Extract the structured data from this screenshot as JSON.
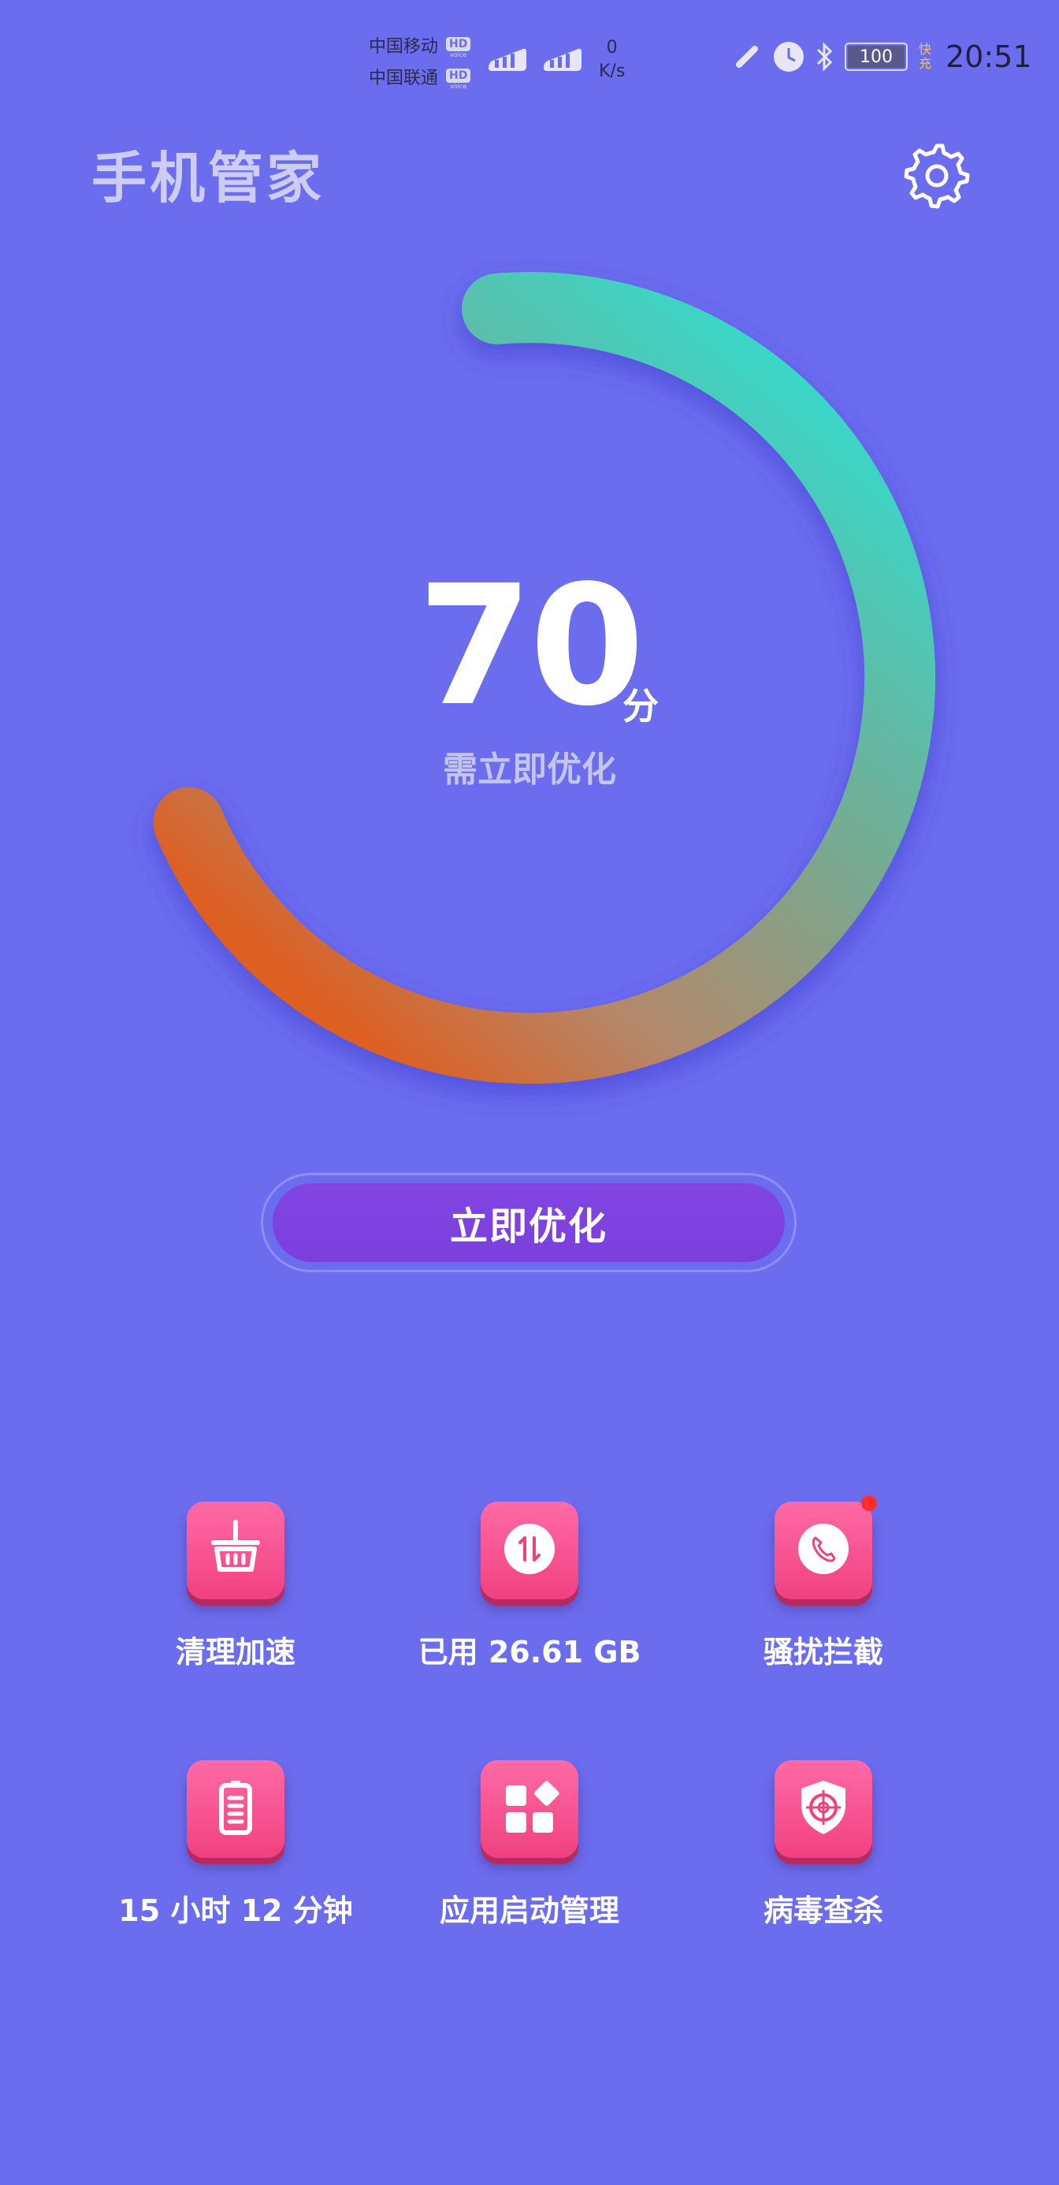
{
  "status_bar": {
    "carrier1": "中国移动",
    "carrier2": "中国联通",
    "hd_label": "HD",
    "voice_label": "voice",
    "net_speed_value": "0",
    "net_speed_unit": "K/s",
    "battery": "100",
    "fast_charge": "快充",
    "time": "20:51"
  },
  "header": {
    "title": "手机管家"
  },
  "score": {
    "value": "70",
    "unit": "分",
    "status": "需立即优化",
    "gauge_fraction": 0.7,
    "gradient_start": "#2DE0D2",
    "gradient_end": "#DD5F22"
  },
  "optimize_button": {
    "label": "立即优化"
  },
  "features": [
    {
      "label": "清理加速"
    },
    {
      "label": "已用 26.61 GB"
    },
    {
      "label": "骚扰拦截"
    },
    {
      "label": "15 小时 12 分钟"
    },
    {
      "label": "应用启动管理"
    },
    {
      "label": "病毒查杀"
    }
  ],
  "colors": {
    "background": "#6B6CEE",
    "tile_pink": "#F0417F",
    "button_purple": "#7C40DE",
    "notification_dot": "#FF2D2D"
  }
}
